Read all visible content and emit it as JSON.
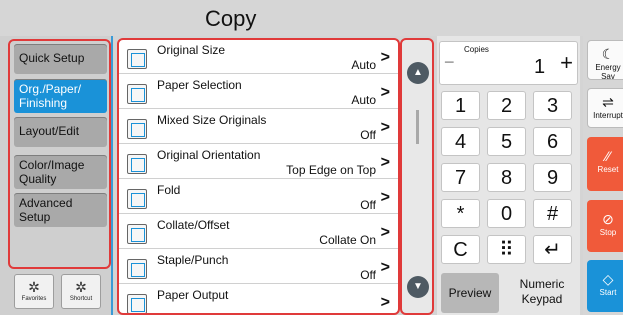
{
  "title": "Copy",
  "categories": [
    {
      "label": "Quick Setup"
    },
    {
      "label": "Org./Paper/ Finishing"
    },
    {
      "label": "Layout/Edit"
    },
    {
      "label": "Color/Image Quality"
    },
    {
      "label": "Advanced Setup"
    }
  ],
  "bottom_buttons": {
    "favorites": "Favorites",
    "shortcut": "Shortcut"
  },
  "settings": [
    {
      "label": "Original Size",
      "value": "Auto"
    },
    {
      "label": "Paper Selection",
      "value": "Auto"
    },
    {
      "label": "Mixed Size Originals",
      "value": "Off"
    },
    {
      "label": "Original Orientation",
      "value": "Top Edge on Top"
    },
    {
      "label": "Fold",
      "value": "Off"
    },
    {
      "label": "Collate/Offset",
      "value": "Collate On"
    },
    {
      "label": "Staple/Punch",
      "value": "Off"
    },
    {
      "label": "Paper Output",
      "value": ""
    }
  ],
  "copies": {
    "label": "Copies",
    "value": "1",
    "minus": "−",
    "plus": "+"
  },
  "keys": [
    "1",
    "2",
    "3",
    "4",
    "5",
    "6",
    "7",
    "8",
    "9",
    "*",
    "0",
    "#",
    "C",
    "⠿",
    "↵"
  ],
  "preview_label": "Preview",
  "numeric_keypad_label": "Numeric Keypad",
  "actions": {
    "energy_saver": "Energy Sav",
    "interrupt": "Interrupt",
    "reset": "Reset",
    "stop": "Stop",
    "start": "Start"
  },
  "colors": {
    "accent": "#1a92d8",
    "highlight": "#e03a3a",
    "action_red": "#f05a3a"
  }
}
